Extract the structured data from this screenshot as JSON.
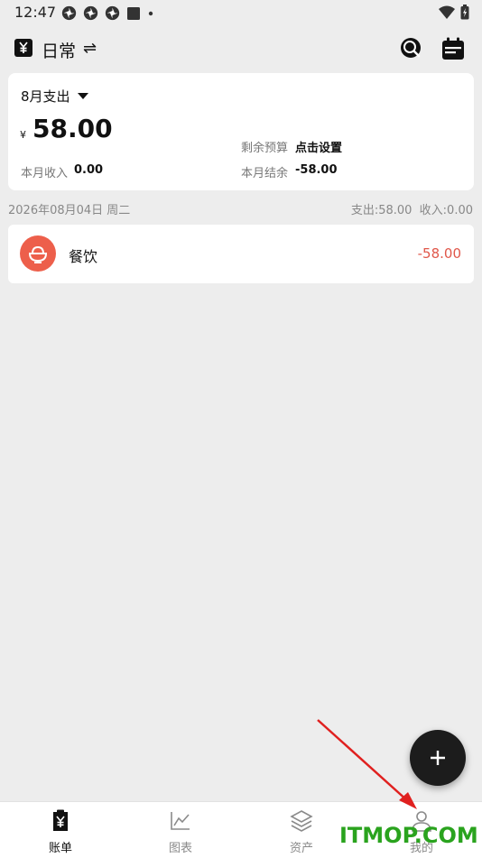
{
  "status_bar": {
    "time": "12:47",
    "icons_left": [
      "pinwheel-icon",
      "pinwheel-icon",
      "pinwheel-icon",
      "square-icon",
      "dot-icon"
    ],
    "icons_right": [
      "wifi-icon",
      "battery-icon"
    ]
  },
  "header": {
    "book_title": "日常",
    "swap_symbol": "⇌"
  },
  "summary": {
    "month_label": "8月支出",
    "currency": "¥",
    "total": "58.00",
    "budget_label": "剩余预算",
    "budget_value": "点击设置",
    "income_label": "本月收入",
    "income_value": "0.00",
    "balance_label": "本月结余",
    "balance_value": "-58.00"
  },
  "day": {
    "date": "2026年08月04日 周二",
    "summary": "支出:58.00  收入:0.00"
  },
  "records": [
    {
      "category": "餐饮",
      "amount": "-58.00",
      "icon": "rice-bowl-icon",
      "icon_color": "#ed5f4b"
    }
  ],
  "fab": {
    "symbol": "+"
  },
  "nav": {
    "items": [
      {
        "label": "账单",
        "icon": "bill-icon",
        "active": true
      },
      {
        "label": "图表",
        "icon": "chart-icon",
        "active": false
      },
      {
        "label": "资产",
        "icon": "layers-icon",
        "active": false
      },
      {
        "label": "我的",
        "icon": "person-icon",
        "active": false
      }
    ]
  },
  "overlay": {
    "watermark": "ITMOP.COM",
    "arrow_color": "#e0201f"
  },
  "colors": {
    "background": "#ededed",
    "expense_red": "#e0574a",
    "fab": "#1c1c1c"
  }
}
